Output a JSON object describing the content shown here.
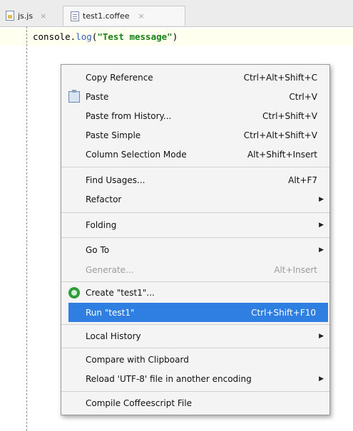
{
  "tabs": [
    {
      "label": "js.js",
      "close": "×"
    },
    {
      "label": "test1.coffee",
      "close": "×"
    }
  ],
  "editor": {
    "code_prefix": "console.",
    "code_fn": "log",
    "code_open": "(",
    "code_string": "\"Test message\"",
    "code_close": ")"
  },
  "context_menu": {
    "items": [
      {
        "label": "Copy Reference",
        "shortcut": "Ctrl+Alt+Shift+C"
      },
      {
        "label": "Paste",
        "shortcut": "Ctrl+V",
        "icon": "paste-icon"
      },
      {
        "label": "Paste from History...",
        "shortcut": "Ctrl+Shift+V"
      },
      {
        "label": "Paste Simple",
        "shortcut": "Ctrl+Alt+Shift+V"
      },
      {
        "label": "Column Selection Mode",
        "shortcut": "Alt+Shift+Insert"
      },
      {
        "label": "Find Usages...",
        "shortcut": "Alt+F7"
      },
      {
        "label": "Refactor",
        "submenu": true
      },
      {
        "label": "Folding",
        "submenu": true
      },
      {
        "label": "Go To",
        "submenu": true
      },
      {
        "label": "Generate...",
        "shortcut": "Alt+Insert",
        "disabled": true
      },
      {
        "label": "Create  \"test1\"...",
        "icon": "coffeescript-icon"
      },
      {
        "label": "Run \"test1\"",
        "shortcut": "Ctrl+Shift+F10",
        "icon": "run-icon",
        "selected": true
      },
      {
        "label": "Local History",
        "submenu": true
      },
      {
        "label": "Compare with Clipboard"
      },
      {
        "label": "Reload 'UTF-8' file in another encoding",
        "submenu": true
      },
      {
        "label": "Compile Coffeescript File"
      }
    ]
  },
  "colors": {
    "selection": "#2f7fe3",
    "run_icon": "#2b9c3c",
    "string": "#178017"
  }
}
